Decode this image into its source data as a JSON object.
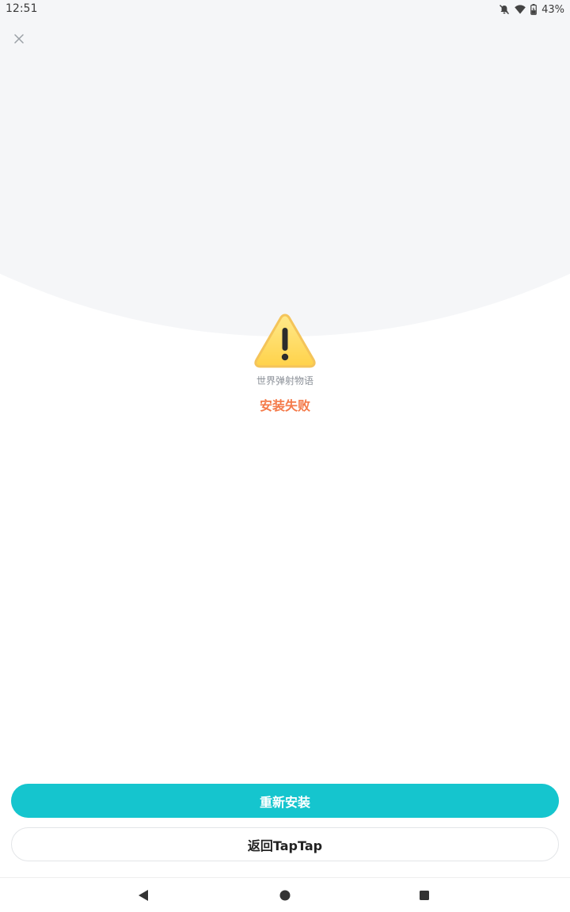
{
  "status_bar": {
    "time": "12:51",
    "battery": "43%",
    "icons": [
      "notifications-off-icon",
      "wifi-icon",
      "battery-charging-icon"
    ]
  },
  "header": {
    "close_icon": "close-icon"
  },
  "main": {
    "status_icon": "warning-icon",
    "app_name": "世界弹射物语",
    "status_text": "安装失败"
  },
  "actions": {
    "reinstall_label": "重新安装",
    "back_label": "返回TapTap"
  },
  "nav_bar": {
    "icons": [
      "back-icon",
      "home-icon",
      "recents-icon"
    ]
  },
  "colors": {
    "accent": "#15c5ce",
    "error": "#f47a4a",
    "background_top": "#f5f6f8"
  }
}
